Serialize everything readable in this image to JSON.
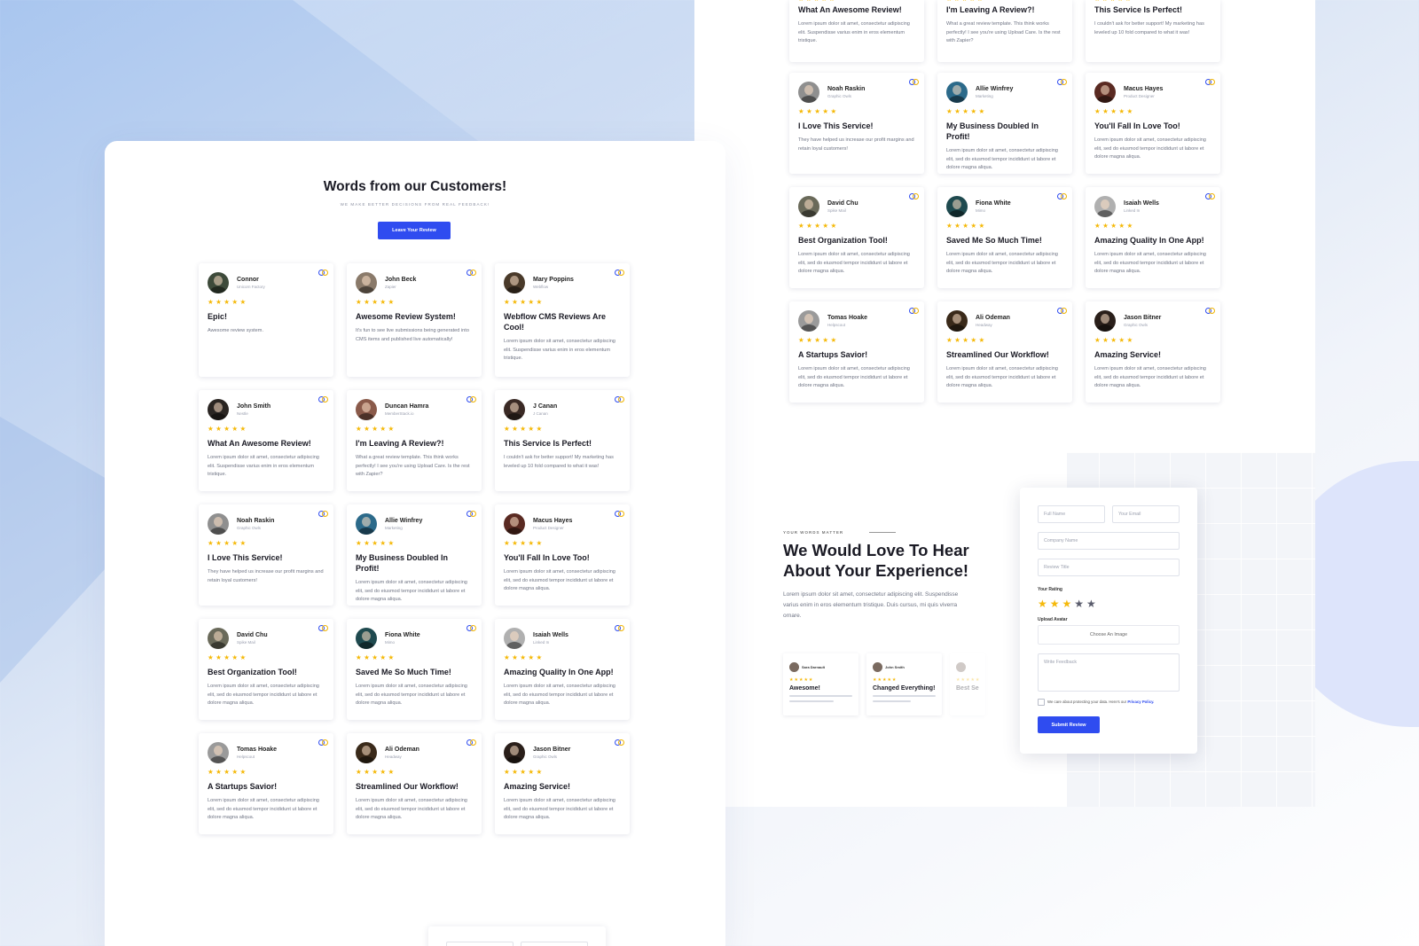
{
  "left_page": {
    "title": "Words from our Customers!",
    "subtitle": "WE MAKE BETTER DECISIONS FROM REAL FEEDBACK!",
    "cta_label": "Leave Your Review",
    "reviews": [
      {
        "name": "Connor",
        "company": "Unicorn Factory",
        "stars": "★★★★★",
        "title": "Epic!",
        "text": "Awesome review system.",
        "avatar_color": "#3d4a3a"
      },
      {
        "name": "John Beck",
        "company": "Zapier",
        "stars": "★★★★★",
        "title": "Awesome Review System!",
        "text": "It's fun to see live submissions being generated into CMS items and published live automatically!",
        "avatar_color": "#8a7a6a"
      },
      {
        "name": "Mary Poppins",
        "company": "Webflow",
        "stars": "★★★★★",
        "title": "Webflow CMS Reviews Are Cool!",
        "text": "Lorem ipsum dolor sit amet, consectetur adipiscing elit. Suspendisse varius enim in eros elementum tristique.",
        "avatar_color": "#4a3a2a"
      },
      {
        "name": "John Smith",
        "company": "Nestle",
        "stars": "★★★★★",
        "title": "What An Awesome Review!",
        "text": "Lorem ipsum dolor sit amet, consectetur adipiscing elit. Suspendisse varius enim in eros elementum tristique.",
        "avatar_color": "#2a2522"
      },
      {
        "name": "Duncan Hamra",
        "company": "MemberStack.io",
        "stars": "★★★★★",
        "title": "I'm Leaving A Review?!",
        "text": "What a great review template. This think works perfectly! I see you're using Upload Care. Is the rest with Zapier?",
        "avatar_color": "#8a5a4a"
      },
      {
        "name": "J Canan",
        "company": "J Canan",
        "stars": "★★★★★",
        "title": "This Service Is Perfect!",
        "text": "I couldn't ask for better support! My marketing has leveled up 10 fold compared to what it was!",
        "avatar_color": "#3a2a25"
      },
      {
        "name": "Noah Raskin",
        "company": "Graphic Owls",
        "stars": "★★★★★",
        "title": "I Love This Service!",
        "text": "They have helped us increase our profit margins and retain loyal customers!",
        "avatar_color": "#8f8f8f"
      },
      {
        "name": "Allie Winfrey",
        "company": "Marketing",
        "stars": "★★★★★",
        "title": "My Business Doubled In Profit!",
        "text": "Lorem ipsum dolor sit amet, consectetur adipiscing elit, sed do eiusmod tempor incididunt ut labore et dolore magna aliqua.",
        "avatar_color": "#2c6a8a"
      },
      {
        "name": "Macus Hayes",
        "company": "Product Designer",
        "stars": "★★★★★",
        "title": "You'll Fall In Love Too!",
        "text": "Lorem ipsum dolor sit amet, consectetur adipiscing elit, sed do eiusmod tempor incididunt ut labore et dolore magna aliqua.",
        "avatar_color": "#5a2a22"
      },
      {
        "name": "David Chu",
        "company": "Spike Mail",
        "stars": "★★★★★",
        "title": "Best Organization Tool!",
        "text": "Lorem ipsum dolor sit amet, consectetur adipiscing elit, sed do eiusmod tempor incididunt ut labore et dolore magna aliqua.",
        "avatar_color": "#6a6a5a"
      },
      {
        "name": "Fiona White",
        "company": "Mimo",
        "stars": "★★★★★",
        "title": "Saved Me So Much Time!",
        "text": "Lorem ipsum dolor sit amet, consectetur adipiscing elit, sed do eiusmod tempor incididunt ut labore et dolore magna aliqua.",
        "avatar_color": "#1f4a4f"
      },
      {
        "name": "Isaiah Wells",
        "company": "Linked In",
        "stars": "★★★★★",
        "title": "Amazing Quality In One App!",
        "text": "Lorem ipsum dolor sit amet, consectetur adipiscing elit, sed do eiusmod tempor incididunt ut labore et dolore magna aliqua.",
        "avatar_color": "#b0b0b0"
      },
      {
        "name": "Tomas Hoake",
        "company": "Helpscout",
        "stars": "★★★★★",
        "title": "A Startups Savior!",
        "text": "Lorem ipsum dolor sit amet, consectetur adipiscing elit, sed do eiusmod tempor incididunt ut labore et dolore magna aliqua.",
        "avatar_color": "#9a9a9a"
      },
      {
        "name": "Ali Odeman",
        "company": "Headway",
        "stars": "★★★★★",
        "title": "Streamlined Our Workflow!",
        "text": "Lorem ipsum dolor sit amet, consectetur adipiscing elit, sed do eiusmod tempor incididunt ut labore et dolore magna aliqua.",
        "avatar_color": "#3a2a1a"
      },
      {
        "name": "Jason Bitner",
        "company": "Graphic Owls",
        "stars": "★★★★★",
        "title": "Amazing Service!",
        "text": "Lorem ipsum dolor sit amet, consectetur adipiscing elit, sed do eiusmod tempor incididunt ut labore et dolore magna aliqua.",
        "avatar_color": "#2a1f1a"
      }
    ]
  },
  "right_page": {
    "partial_top": [
      {
        "stars": "★★★★★",
        "title": "What An Awesome Review!",
        "text": "Lorem ipsum dolor sit amet, consectetur adipiscing elit. Suspendisse varius enim in eros elementum tristique."
      },
      {
        "stars": "★★★★★",
        "title": "I'm Leaving A Review?!",
        "text": "What a great review template. This think works perfectly! I see you're using Upload Care. Is the rest with Zapier?"
      },
      {
        "stars": "★★★★★",
        "title": "This Service Is Perfect!",
        "text": "I couldn't ask for better support! My marketing has leveled up 10 fold compared to what it was!"
      }
    ],
    "reviews": [
      {
        "name": "Noah Raskin",
        "company": "Graphic Owls",
        "stars": "★★★★★",
        "title": "I Love This Service!",
        "text": "They have helped us increase our profit margins and retain loyal customers!",
        "avatar_color": "#8f8f8f"
      },
      {
        "name": "Allie Winfrey",
        "company": "Marketing",
        "stars": "★★★★★",
        "title": "My Business Doubled In Profit!",
        "text": "Lorem ipsum dolor sit amet, consectetur adipiscing elit, sed do eiusmod tempor incididunt ut labore et dolore magna aliqua.",
        "avatar_color": "#2c6a8a"
      },
      {
        "name": "Macus Hayes",
        "company": "Product Designer",
        "stars": "★★★★★",
        "title": "You'll Fall In Love Too!",
        "text": "Lorem ipsum dolor sit amet, consectetur adipiscing elit, sed do eiusmod tempor incididunt ut labore et dolore magna aliqua.",
        "avatar_color": "#5a2a22"
      },
      {
        "name": "David Chu",
        "company": "Spike Mail",
        "stars": "★★★★★",
        "title": "Best Organization Tool!",
        "text": "Lorem ipsum dolor sit amet, consectetur adipiscing elit, sed do eiusmod tempor incididunt ut labore et dolore magna aliqua.",
        "avatar_color": "#6a6a5a"
      },
      {
        "name": "Fiona White",
        "company": "Mimo",
        "stars": "★★★★★",
        "title": "Saved Me So Much Time!",
        "text": "Lorem ipsum dolor sit amet, consectetur adipiscing elit, sed do eiusmod tempor incididunt ut labore et dolore magna aliqua.",
        "avatar_color": "#1f4a4f"
      },
      {
        "name": "Isaiah Wells",
        "company": "Linked In",
        "stars": "★★★★★",
        "title": "Amazing Quality In One App!",
        "text": "Lorem ipsum dolor sit amet, consectetur adipiscing elit, sed do eiusmod tempor incididunt ut labore et dolore magna aliqua.",
        "avatar_color": "#b0b0b0"
      },
      {
        "name": "Tomas Hoake",
        "company": "Helpscout",
        "stars": "★★★★★",
        "title": "A Startups Savior!",
        "text": "Lorem ipsum dolor sit amet, consectetur adipiscing elit, sed do eiusmod tempor incididunt ut labore et dolore magna aliqua.",
        "avatar_color": "#9a9a9a"
      },
      {
        "name": "Ali Odeman",
        "company": "Headway",
        "stars": "★★★★★",
        "title": "Streamlined Our Workflow!",
        "text": "Lorem ipsum dolor sit amet, consectetur adipiscing elit, sed do eiusmod tempor incididunt ut labore et dolore magna aliqua.",
        "avatar_color": "#3a2a1a"
      },
      {
        "name": "Jason Bitner",
        "company": "Graphic Owls",
        "stars": "★★★★★",
        "title": "Amazing Service!",
        "text": "Lorem ipsum dolor sit amet, consectetur adipiscing elit, sed do eiusmod tempor incididunt ut labore et dolore magna aliqua.",
        "avatar_color": "#2a1f1a"
      }
    ],
    "form_section": {
      "eyebrow": "YOUR WORDS MATTER",
      "title": "We Would Love To Hear About Your Experience!",
      "description": "Lorem ipsum dolor sit amet, consectetur adipiscing elit. Suspendisse varius enim in eros elementum tristique. Duis cursus, mi quis viverra ornare.",
      "mini_cards": [
        {
          "name": "Sara Darnault",
          "stars": "★★★★★",
          "title": "Awesome!"
        },
        {
          "name": "John Smith",
          "stars": "★★★★★",
          "title": "Changed Everything!"
        },
        {
          "name": "",
          "stars": "★★★★★",
          "title": "Best Se"
        }
      ],
      "form": {
        "full_name_placeholder": "Full Name",
        "email_placeholder": "Your Email",
        "company_placeholder": "Company Name",
        "review_title_placeholder": "Review Title",
        "rating_label": "Your Rating",
        "rating_stars_on": "★★★",
        "rating_stars_off": "★★",
        "rating_value": 3,
        "upload_label": "Upload Avatar",
        "upload_button": "Choose An Image",
        "feedback_placeholder": "Write Feedback",
        "privacy_text": "We care about protecting your data. Here's our",
        "privacy_link": "Privacy Policy.",
        "submit_label": "Submit Review"
      }
    }
  },
  "colors": {
    "accent": "#2f4cf0",
    "star": "#f5b90a",
    "star_off": "#5a5c6c"
  }
}
